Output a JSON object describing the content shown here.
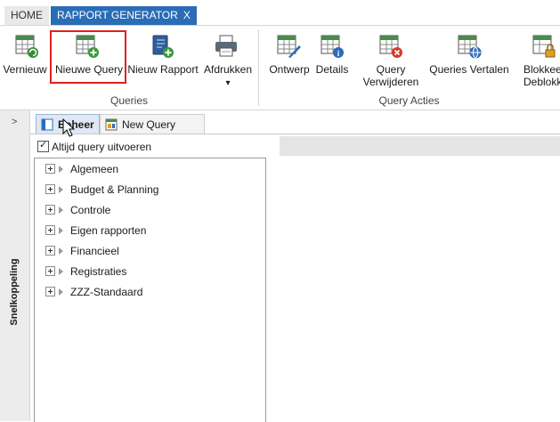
{
  "tabs": [
    {
      "label": "HOME"
    },
    {
      "label": "RAPPORT GENERATOR",
      "close": "X"
    }
  ],
  "ribbon": {
    "buttons": [
      {
        "label": "Vernieuw",
        "icon": "refresh-grid-icon"
      },
      {
        "label": "Nieuwe Query",
        "icon": "new-query-icon"
      },
      {
        "label": "Nieuw Rapport",
        "icon": "new-report-icon"
      },
      {
        "label": "Afdrukken",
        "icon": "printer-icon",
        "arrow": "▾"
      },
      {
        "label": "Ontwerp",
        "icon": "design-icon"
      },
      {
        "label": "Details",
        "icon": "details-icon"
      },
      {
        "label": "Query",
        "label2": "Verwijderen",
        "icon": "delete-query-icon"
      },
      {
        "label": "Queries Vertalen",
        "icon": "translate-icon"
      },
      {
        "label": "Blokkee",
        "label2": "Deblokk",
        "icon": "lock-icon"
      }
    ],
    "groups": [
      "Queries",
      "Query Acties"
    ]
  },
  "sidebar": {
    "arrow": ">",
    "label": "Snelkoppeling"
  },
  "subtabs": [
    {
      "label": "Beheer",
      "icon": "grid-tab-icon"
    },
    {
      "label": "New Query",
      "icon": "query-tab-icon"
    }
  ],
  "panel": {
    "checkbox_label": "Altijd query uitvoeren",
    "checked": true,
    "tree": [
      "Algemeen",
      "Budget & Planning",
      "Controle",
      "Eigen rapporten",
      "Financieel",
      "Registraties",
      "ZZZ-Standaard"
    ]
  },
  "colors": {
    "accent": "#2b6cb6",
    "highlight": "#e02020",
    "grid_green": "#3a8a3a"
  }
}
